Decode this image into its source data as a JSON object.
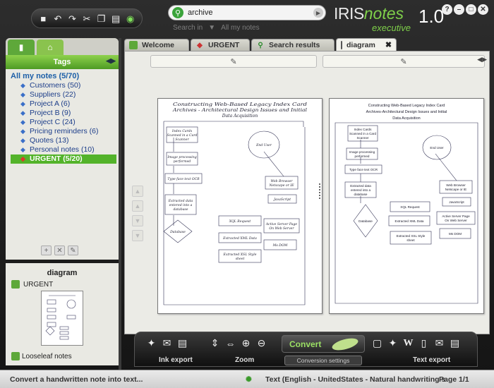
{
  "app": {
    "logo_iris": "IRIS",
    "logo_notes": "notes",
    "logo_edition": "executive",
    "logo_version": "1.0"
  },
  "search": {
    "value": "archive",
    "search_in_label": "Search in",
    "scope": "All my notes"
  },
  "left_panel": {
    "tags_header": "Tags",
    "root_label": "All my notes (5/70)",
    "tags": [
      {
        "label": "Customers (50)",
        "color": "#3a6fc8"
      },
      {
        "label": "Suppliers (22)",
        "color": "#3a6fc8"
      },
      {
        "label": "Project A (6)",
        "color": "#3a6fc8"
      },
      {
        "label": "Project B (9)",
        "color": "#3a6fc8"
      },
      {
        "label": "Project C (24)",
        "color": "#3a6fc8"
      },
      {
        "label": "Pricing reminders (6)",
        "color": "#3a6fc8"
      },
      {
        "label": "Quotes (13)",
        "color": "#3a6fc8"
      },
      {
        "label": "Personal notes (10)",
        "color": "#3a6fc8"
      },
      {
        "label": "URGENT (5/20)",
        "color": "#d83a2a",
        "selected": true
      }
    ]
  },
  "preview": {
    "title": "diagram",
    "tag": "URGENT",
    "source": "Looseleaf notes"
  },
  "tabs": [
    {
      "label": "Welcome",
      "icon": "notebook-icon"
    },
    {
      "label": "URGENT",
      "icon": "tag-icon"
    },
    {
      "label": "Search results",
      "icon": "search-icon"
    },
    {
      "label": "diagram",
      "icon": "page-icon",
      "active": true
    }
  ],
  "document": {
    "handwritten_title": "Constructing Web-Based Legacy Index Card Archives - Architectural Design Issues and Initial Data Acquisition",
    "typed_title_1": "Constructing Web-Based Legacy Index Card",
    "typed_title_2": "Archives-Architectural Design Issues and Initial",
    "typed_title_3": "Data Acquisition",
    "boxes": [
      {
        "id": "index",
        "lines": [
          "Index Cards",
          "Scanned in a Card",
          "Scanner"
        ]
      },
      {
        "id": "imgproc",
        "lines": [
          "Image processing",
          "performed"
        ]
      },
      {
        "id": "ocr",
        "lines": [
          "Type face text OCR"
        ]
      },
      {
        "id": "extract",
        "lines": [
          "Extracted data",
          "entered into a",
          "database"
        ]
      },
      {
        "id": "db",
        "lines": [
          "Database"
        ]
      },
      {
        "id": "xql",
        "lines": [
          "XQL Request"
        ]
      },
      {
        "id": "xmldata",
        "lines": [
          "Extracted XML Data"
        ]
      },
      {
        "id": "xsl",
        "lines": [
          "Extracted XSL Style",
          "sheet"
        ]
      },
      {
        "id": "enduser",
        "lines": [
          "End User"
        ]
      },
      {
        "id": "browser",
        "lines": [
          "Web Browser",
          "Netscape or IE"
        ]
      },
      {
        "id": "js",
        "lines": [
          "JavaScript"
        ]
      },
      {
        "id": "asp",
        "lines": [
          "Active Server Page",
          "On Web Server"
        ]
      },
      {
        "id": "msdom",
        "lines": [
          "Ms DOM"
        ]
      }
    ]
  },
  "toolbar": {
    "ink_export": "Ink export",
    "zoom": "Zoom",
    "convert": "Convert",
    "conversion_settings": "Conversion settings",
    "text_export": "Text export"
  },
  "status": {
    "hint": "Convert a handwritten note into text...",
    "language": "Text (English - UnitedStates - Natural handwriting s",
    "page": "Page 1/1"
  }
}
